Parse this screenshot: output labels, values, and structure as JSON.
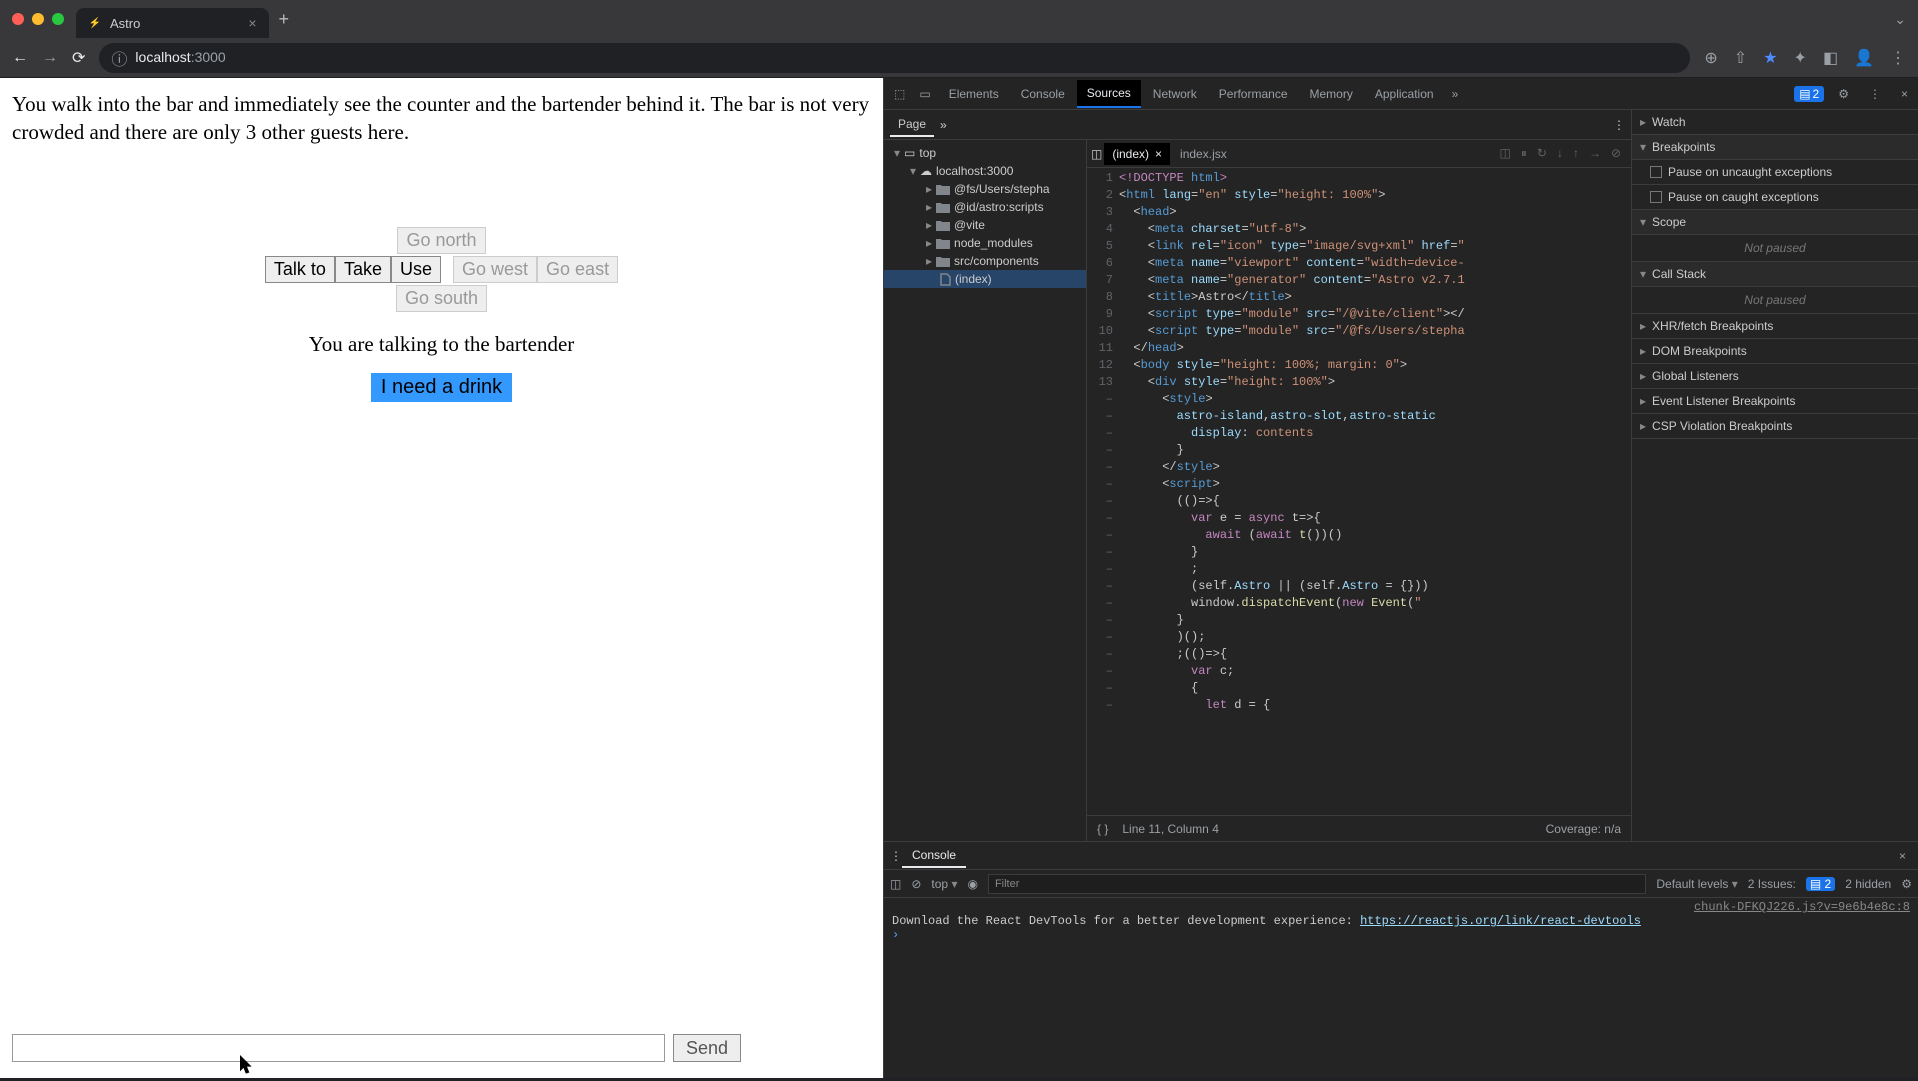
{
  "window": {
    "tab_title": "Astro",
    "url_host": "localhost",
    "url_port": ":3000"
  },
  "game": {
    "narrative": "You walk into the bar and immediately see the counter and the bartender behind it. The bar is not very crowded and there are only 3 other guests here.",
    "actions": {
      "talk_to": "Talk to",
      "take": "Take",
      "use": "Use"
    },
    "directions": {
      "north": "Go north",
      "south": "Go south",
      "west": "Go west",
      "east": "Go east"
    },
    "status": "You are talking to the bartender",
    "choice": "I need a drink",
    "send": "Send"
  },
  "devtools": {
    "tabs": [
      "Elements",
      "Console",
      "Sources",
      "Network",
      "Performance",
      "Memory",
      "Application"
    ],
    "active_tab": "Sources",
    "issues_count": "2",
    "subtab_active": "Page",
    "tree": {
      "top": "top",
      "host": "localhost:3000",
      "items": [
        "@fs/Users/stepha",
        "@id/astro:scripts",
        "@vite",
        "node_modules",
        "src/components"
      ],
      "file": "(index)"
    },
    "open_tabs": [
      {
        "name": "(index)",
        "active": true
      },
      {
        "name": "index.jsx",
        "active": false
      }
    ],
    "gutter_nums": [
      "1",
      "2",
      "3",
      "4",
      "5",
      "6",
      "7",
      "8",
      "9",
      "10",
      "11",
      "12",
      "13",
      "–",
      "–",
      "–",
      "–",
      "–",
      "–",
      "–",
      "–",
      "–",
      "–",
      "–",
      "–",
      "–",
      "–",
      "–",
      "–",
      "–",
      "–",
      "–"
    ],
    "status_line": "Line 11, Column 4",
    "coverage": "Coverage: n/a",
    "right_panel": {
      "watch": "Watch",
      "breakpoints": "Breakpoints",
      "uncaught": "Pause on uncaught exceptions",
      "caught": "Pause on caught exceptions",
      "scope": "Scope",
      "not_paused": "Not paused",
      "call_stack": "Call Stack",
      "items": [
        "XHR/fetch Breakpoints",
        "DOM Breakpoints",
        "Global Listeners",
        "Event Listener Breakpoints",
        "CSP Violation Breakpoints"
      ]
    }
  },
  "console": {
    "tab": "Console",
    "context": "top",
    "filter_placeholder": "Filter",
    "levels": "Default levels",
    "issues_label": "2 Issues:",
    "issues_badge": "2",
    "hidden": "2 hidden",
    "src_file": "chunk-DFKQJ226.js?v=9e6b4e8c:8",
    "msg": "Download the React DevTools for a better development experience: ",
    "link": "https://reactjs.org/link/react-devtools"
  }
}
